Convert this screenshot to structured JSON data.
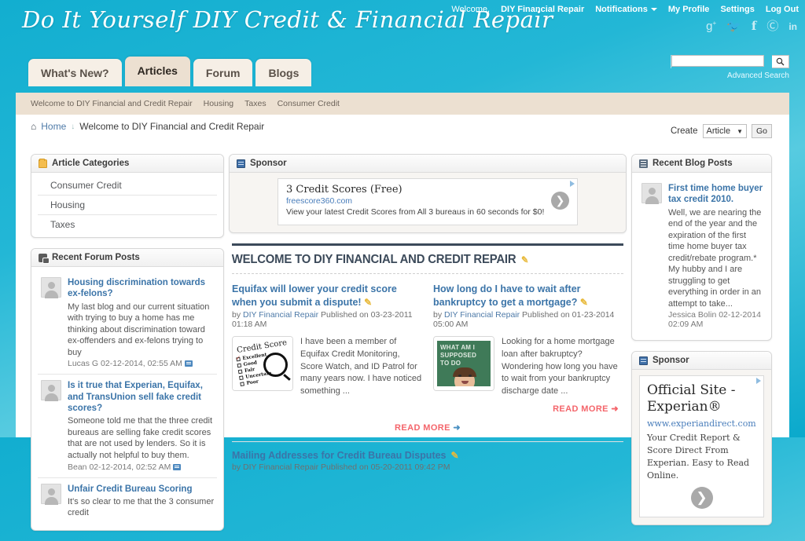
{
  "site": {
    "title": "Do It Yourself DIY Credit & Financial Repair"
  },
  "topbar": {
    "welcome_label": "Welcome,",
    "username": "DIY Financial Repair",
    "notifications": "Notifications",
    "my_profile": "My Profile",
    "settings": "Settings",
    "log_out": "Log Out",
    "social": [
      "google-plus-icon",
      "twitter-icon",
      "facebook-icon",
      "pinterest-icon",
      "linkedin-icon"
    ]
  },
  "search": {
    "value": "",
    "placeholder": "",
    "advanced_label": "Advanced Search",
    "button_icon": "search-icon"
  },
  "tabs": [
    {
      "label": "What's New?",
      "active": false
    },
    {
      "label": "Articles",
      "active": true
    },
    {
      "label": "Forum",
      "active": false
    },
    {
      "label": "Blogs",
      "active": false
    }
  ],
  "subnav": [
    "Welcome to DIY Financial and Credit Repair",
    "Housing",
    "Taxes",
    "Consumer Credit"
  ],
  "breadcrumb": {
    "home": "Home",
    "separator": "↓",
    "current": "Welcome to DIY Financial and Credit Repair"
  },
  "create": {
    "label": "Create",
    "selected": "Article",
    "go_label": "Go"
  },
  "left_column": {
    "categories_block": {
      "title": "Article Categories",
      "icon": "folder-icon",
      "items": [
        "Consumer Credit",
        "Housing",
        "Taxes"
      ]
    },
    "forum_block": {
      "title": "Recent Forum Posts",
      "icon": "forum-icon",
      "posts": [
        {
          "title": "Housing discrimination towards ex-felons?",
          "snippet": "My last blog and our current situation with trying to buy a home has me thinking about discrimination toward ex-offenders and ex-felons trying to buy",
          "meta": "Lucas G 02-12-2014, 02:55 AM"
        },
        {
          "title": "Is it true that Experian, Equifax, and TransUnion sell fake credit scores?",
          "snippet": "Someone told me that the three credit bureaus are selling fake credit scores that are not used by lenders. So it is actually not helpful to buy them.",
          "meta": "Bean 02-12-2014, 02:52 AM"
        },
        {
          "title": "Unfair Credit Bureau Scoring",
          "snippet": "It's so clear to me that the 3 consumer credit",
          "meta": ""
        }
      ]
    }
  },
  "center_column": {
    "sponsor": {
      "title": "Sponsor",
      "icon": "ad-icon",
      "ad": {
        "headline": "3 Credit Scores (Free)",
        "url": "freescore360.com",
        "description": "View your latest Credit Scores from All 3 bureaus in 60 seconds for $0!",
        "adchoices_icon": "adchoices-icon",
        "arrow_icon": "chevron-right-icon"
      }
    },
    "section_title": "WELCOME TO DIY FINANCIAL AND CREDIT REPAIR",
    "section_edit_icon": "pencil-icon",
    "articles": [
      {
        "title": "Equifax will lower your credit score when you submit a dispute!",
        "edit_icon": "pencil-icon",
        "byline_prefix": "by",
        "author": "DIY Financial Repair",
        "published": "Published on 03-23-2011 01:18 AM",
        "excerpt": "I have been a member of Equifax Credit Monitoring, Score Watch, and ID Patrol for many years now. I have noticed something ...",
        "thumbnail": "credit-score-checklist-thumbnail",
        "thumb_text": {
          "title": "Credit Score",
          "options": [
            "Excellent",
            "Good",
            "Fair",
            "Uncertain",
            "Poor"
          ],
          "checked": "Poor"
        }
      },
      {
        "title": "How long do I have to wait after bankruptcy to get a mortgage?",
        "edit_icon": "pencil-icon",
        "byline_prefix": "by",
        "author": "DIY Financial Repair",
        "published": "Published on 01-23-2014 05:00 AM",
        "excerpt": "Looking for a home mortgage loan after bakruptcy? Wondering how long you have to wait from your bankruptcy discharge date ...",
        "thumbnail": "chalkboard-man-thumbnail",
        "thumb_text": {
          "lines": [
            "WHAT AM I",
            "SUPPOSED",
            "TO DO"
          ]
        },
        "read_more": "READ MORE"
      }
    ],
    "read_more": "READ MORE",
    "next_article": {
      "title": "Mailing Addresses for Credit Bureau Disputes",
      "edit_icon": "pencil-icon",
      "byline": "by DIY Financial Repair Published on 05-20-2011 09:42 PM"
    }
  },
  "right_column": {
    "blog_block": {
      "title": "Recent Blog Posts",
      "icon": "blog-icon",
      "posts": [
        {
          "title": "First time home buyer tax credit 2010.",
          "snippet": "Well, we are nearing the end of the year and the expiration of the first time home buyer tax credit/rebate program.* My hubby and I are struggling to get everything in order in an attempt to take...",
          "meta": "Jessica Bolin 02-12-2014 02:09 AM"
        }
      ]
    },
    "sponsor": {
      "title": "Sponsor",
      "icon": "ad-icon",
      "ad": {
        "headline": "Official Site - Experian®",
        "url": "www.experiandirect.com",
        "description": "Your Credit Report & Score Direct From Experian. Easy to Read Online.",
        "adchoices_icon": "adchoices-icon",
        "arrow_icon": "chevron-right-icon"
      }
    }
  },
  "colors": {
    "brand_teal": "#12aed0",
    "tab_bg": "#f6efe6",
    "tab_active_bg": "#ece0d1",
    "link_blue": "#3b74a8",
    "read_more_red": "#f4656b",
    "heading_navy": "#3c4a5a"
  }
}
